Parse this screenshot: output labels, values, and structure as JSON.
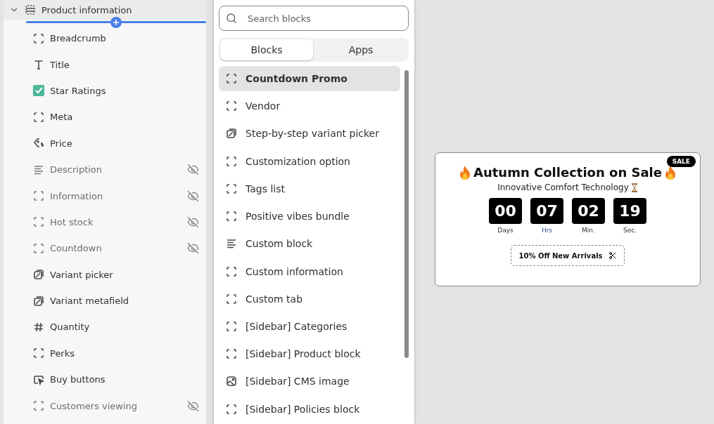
{
  "section": {
    "title": "Product information",
    "expanded": true
  },
  "blocks": [
    {
      "label": "Breadcrumb",
      "kind": "dashed",
      "hidden": false
    },
    {
      "label": "Title",
      "kind": "text",
      "hidden": false
    },
    {
      "label": "Star Ratings",
      "kind": "app",
      "hidden": false
    },
    {
      "label": "Meta",
      "kind": "dashed",
      "hidden": false
    },
    {
      "label": "Price",
      "kind": "price",
      "hidden": false
    },
    {
      "label": "Description",
      "kind": "lines",
      "hidden": true
    },
    {
      "label": "Information",
      "kind": "dashed",
      "hidden": true
    },
    {
      "label": "Hot stock",
      "kind": "dashed",
      "hidden": true
    },
    {
      "label": "Countdown",
      "kind": "dashed",
      "hidden": true
    },
    {
      "label": "Variant picker",
      "kind": "variant",
      "hidden": false
    },
    {
      "label": "Variant metafield",
      "kind": "variant",
      "hidden": false
    },
    {
      "label": "Quantity",
      "kind": "hash",
      "hidden": false
    },
    {
      "label": "Perks",
      "kind": "dashed",
      "hidden": false
    },
    {
      "label": "Buy buttons",
      "kind": "cursor",
      "hidden": false
    },
    {
      "label": "Customers viewing",
      "kind": "dashed",
      "hidden": true
    }
  ],
  "picker": {
    "search": {
      "placeholder": "Search blocks"
    },
    "tabs": [
      {
        "label": "Blocks",
        "selected": true
      },
      {
        "label": "Apps",
        "selected": false
      }
    ],
    "items": [
      {
        "label": "Countdown Promo",
        "kind": "dashed",
        "selected": true
      },
      {
        "label": "Vendor",
        "kind": "dashed",
        "selected": false
      },
      {
        "label": "Step-by-step variant picker",
        "kind": "variant",
        "selected": false
      },
      {
        "label": "Customization option",
        "kind": "dashed",
        "selected": false
      },
      {
        "label": "Tags list",
        "kind": "dashed",
        "selected": false
      },
      {
        "label": "Positive vibes bundle",
        "kind": "dashed",
        "selected": false
      },
      {
        "label": "Custom block",
        "kind": "lines",
        "selected": false
      },
      {
        "label": "Custom information",
        "kind": "dashed",
        "selected": false
      },
      {
        "label": "Custom tab",
        "kind": "dashed",
        "selected": false
      },
      {
        "label": "[Sidebar] Categories",
        "kind": "dashed",
        "selected": false
      },
      {
        "label": "[Sidebar] Product block",
        "kind": "dashed",
        "selected": false
      },
      {
        "label": "[Sidebar] CMS image",
        "kind": "image",
        "selected": false
      },
      {
        "label": "[Sidebar] Policies block",
        "kind": "dashed",
        "selected": false
      }
    ]
  },
  "preview": {
    "badge": "SALE",
    "title": "Autumn Collection on Sale",
    "subtitle": "Innovative Comfort Technology",
    "timer": [
      {
        "value": "00",
        "unit": "Days"
      },
      {
        "value": "07",
        "unit": "Hrs"
      },
      {
        "value": "02",
        "unit": "Min."
      },
      {
        "value": "19",
        "unit": "Sec."
      }
    ],
    "coupon": "10% Off New Arrivals"
  }
}
